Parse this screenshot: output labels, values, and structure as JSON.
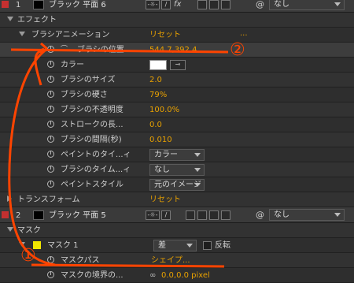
{
  "layer1": {
    "number": "1",
    "name": "ブラック 平面 6",
    "switch_icon": "fx",
    "dropdown": "なし"
  },
  "effects": {
    "label": "エフェクト"
  },
  "brush_anim": {
    "label": "ブラシアニメーション",
    "reset": "リセット",
    "dots": "..."
  },
  "props": [
    {
      "label": "ブラシの位置",
      "value": "544.7,392.4"
    },
    {
      "label": "カラー",
      "value": ""
    },
    {
      "label": "ブラシのサイズ",
      "value": "2.0"
    },
    {
      "label": "ブラシの硬さ",
      "value": "79%"
    },
    {
      "label": "ブラシの不透明度",
      "value": "100.0%"
    },
    {
      "label": "ストロークの長...",
      "value": "0.0"
    },
    {
      "label": "ブラシの間隔(秒)",
      "value": "0.010"
    },
    {
      "label": "ペイントのタイ...ィ",
      "value": "カラー"
    },
    {
      "label": "ブラシのタイム...ィ",
      "value": "なし"
    },
    {
      "label": "ペイントスタイル",
      "value": "元のイメージ"
    }
  ],
  "transform": {
    "label": "トランスフォーム",
    "reset": "リセット"
  },
  "layer2": {
    "number": "2",
    "name": "ブラック 平面 5",
    "dropdown": "なし"
  },
  "mask": {
    "label": "マスク"
  },
  "mask1": {
    "label": "マスク 1",
    "mode": "差",
    "invert_label": "反転"
  },
  "mask_path": {
    "label": "マスクパス",
    "value": "シェイプ..."
  },
  "mask_feather": {
    "label": "マスクの境界の...",
    "value": "0.0,0.0 pixel"
  },
  "annotations": {
    "one": "①",
    "two": "②"
  },
  "colors": {
    "accent": "#e8a100",
    "annotation": "#ff4400",
    "label1": "#c43030",
    "mask_yellow": "#f2e600"
  }
}
